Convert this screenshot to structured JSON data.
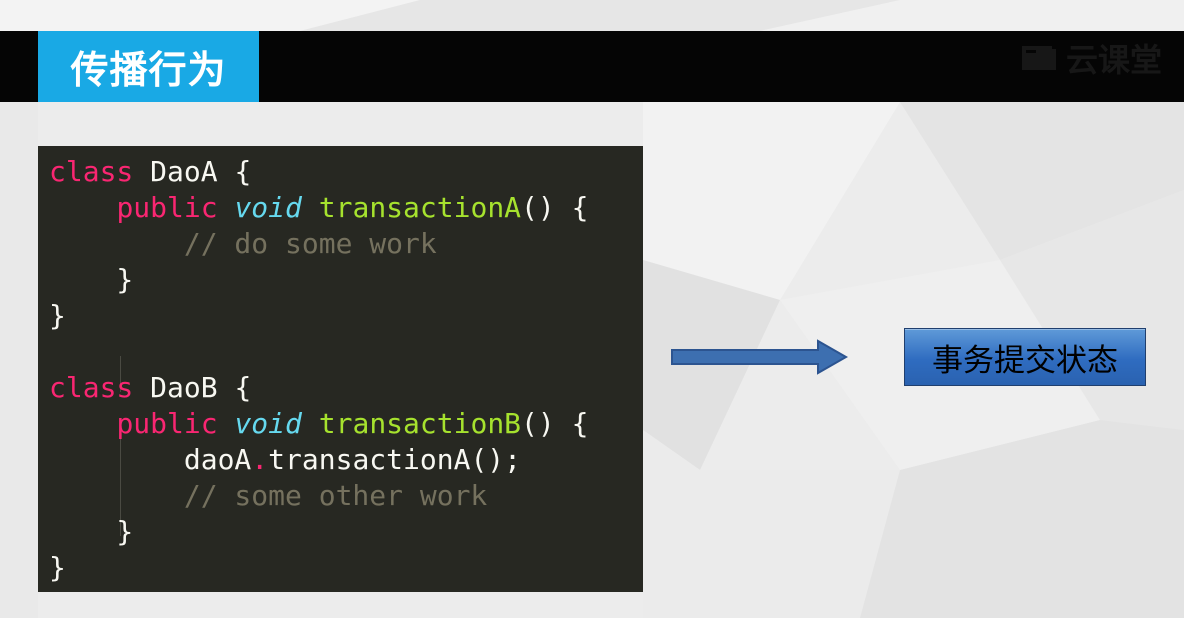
{
  "title": "传播行为",
  "logo": {
    "text": "云课堂",
    "icon": "book-icon"
  },
  "code": {
    "lines": [
      [
        {
          "t": "class",
          "c": "kw"
        },
        {
          "t": " DaoA {",
          "c": "pl"
        }
      ],
      [
        {
          "t": "    ",
          "c": "pl"
        },
        {
          "t": "public",
          "c": "kw"
        },
        {
          "t": " ",
          "c": "pl"
        },
        {
          "t": "void",
          "c": "ty"
        },
        {
          "t": " ",
          "c": "pl"
        },
        {
          "t": "transactionA",
          "c": "fn"
        },
        {
          "t": "() {",
          "c": "pl"
        }
      ],
      [
        {
          "t": "        ",
          "c": "pl"
        },
        {
          "t": "// do some work",
          "c": "cm"
        }
      ],
      [
        {
          "t": "    }",
          "c": "pl"
        }
      ],
      [
        {
          "t": "}",
          "c": "pl"
        }
      ],
      [
        {
          "t": "",
          "c": "pl"
        }
      ],
      [
        {
          "t": "class",
          "c": "kw"
        },
        {
          "t": " DaoB {",
          "c": "pl"
        }
      ],
      [
        {
          "t": "    ",
          "c": "pl"
        },
        {
          "t": "public",
          "c": "kw"
        },
        {
          "t": " ",
          "c": "pl"
        },
        {
          "t": "void",
          "c": "ty"
        },
        {
          "t": " ",
          "c": "pl"
        },
        {
          "t": "transactionB",
          "c": "fn"
        },
        {
          "t": "() {",
          "c": "pl"
        }
      ],
      [
        {
          "t": "        daoA",
          "c": "pl"
        },
        {
          "t": ".",
          "c": "kw"
        },
        {
          "t": "transactionA();",
          "c": "pl"
        }
      ],
      [
        {
          "t": "        ",
          "c": "pl"
        },
        {
          "t": "// some other work",
          "c": "cm"
        }
      ],
      [
        {
          "t": "    }",
          "c": "pl"
        }
      ],
      [
        {
          "t": "}",
          "c": "pl"
        }
      ]
    ]
  },
  "arrow": {
    "icon": "right-arrow-icon",
    "color": "#3d6fb0"
  },
  "state_label": "事务提交状态",
  "colors": {
    "title_bg": "#19a9e5",
    "header_bg": "#050505",
    "code_bg": "#272822",
    "keyword": "#f92672",
    "type": "#66d9ef",
    "function": "#a6e22e",
    "comment": "#75715e",
    "plain": "#f8f8f2",
    "state_box": "#3a78c6"
  }
}
